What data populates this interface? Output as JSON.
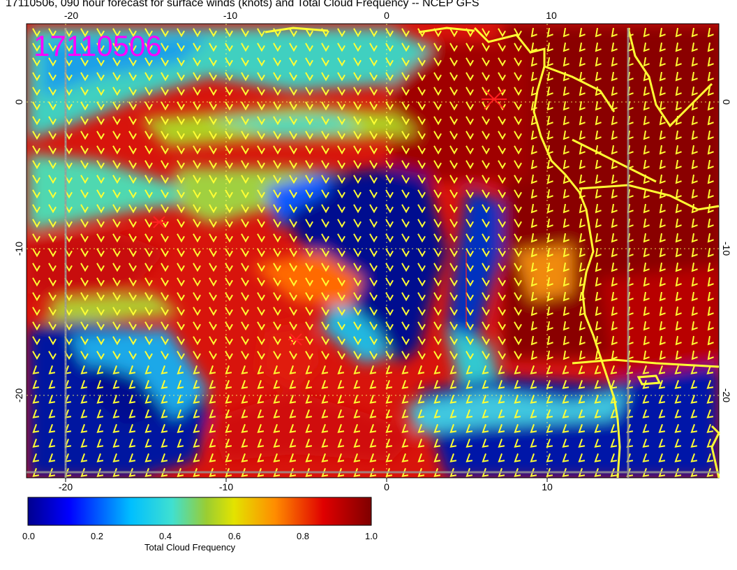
{
  "title": "17110506, 090 hour forecast for surface winds (knots) and Total Cloud Frequency -- NCEP GFS",
  "stamp": "17110506",
  "map": {
    "bottom_axis": [
      "-20",
      "-10",
      "0",
      "10"
    ],
    "top_axis": [
      "-20",
      "-10",
      "0",
      "10"
    ],
    "left_axis": [
      "0",
      "-10",
      "-20"
    ],
    "right_axis": [
      "0",
      "-10",
      "-20"
    ]
  },
  "colorbar": {
    "title": "Total Cloud Frequency",
    "ticks": [
      "0.0",
      "0.2",
      "0.4",
      "0.6",
      "0.8",
      "1.0"
    ],
    "colors": [
      "#00008f",
      "#0000ff",
      "#00bfff",
      "#40e0d0",
      "#9acd32",
      "#e3e300",
      "#ff8c00",
      "#e00000",
      "#7f0000"
    ]
  },
  "colors": {
    "stamp": "#ff00ff",
    "coast": "#ffff33",
    "barbs": "#ffff33",
    "storm_marker": "#ff2020"
  }
}
